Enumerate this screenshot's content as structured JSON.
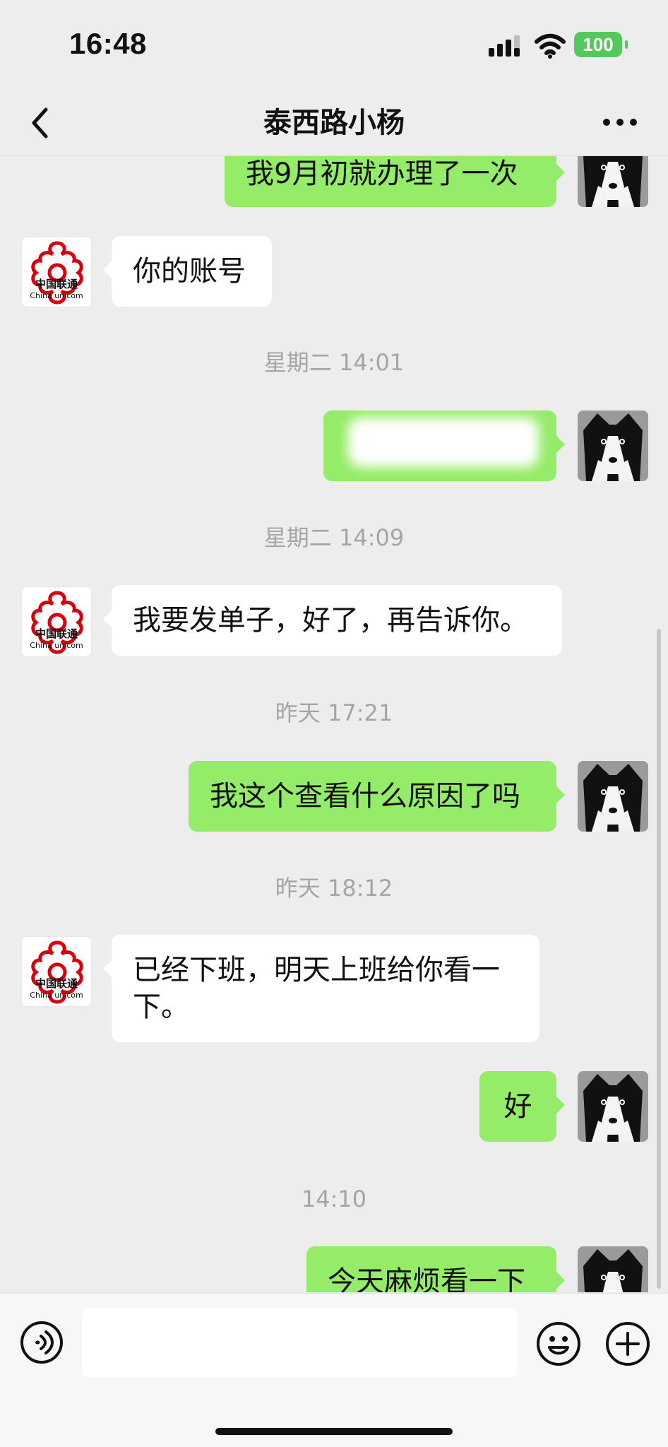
{
  "status_bar": {
    "time": "16:48",
    "battery": "100"
  },
  "header": {
    "title": "泰西路小杨"
  },
  "messages": [
    {
      "side": "outgoing",
      "text": "我9月初就办理了一次"
    },
    {
      "side": "incoming",
      "text": "你的账号"
    },
    {
      "side": "timestamp",
      "text": "星期二 14:01"
    },
    {
      "side": "outgoing",
      "text": ""
    },
    {
      "side": "timestamp",
      "text": "星期二 14:09"
    },
    {
      "side": "incoming",
      "text": "我要发单子，好了，再告诉你。"
    },
    {
      "side": "timestamp",
      "text": "昨天 17:21"
    },
    {
      "side": "outgoing",
      "text": "我这个查看什么原因了吗"
    },
    {
      "side": "timestamp",
      "text": "昨天 18:12"
    },
    {
      "side": "incoming",
      "text": "已经下班，明天上班给你看一下。"
    },
    {
      "side": "outgoing",
      "text": "好"
    },
    {
      "side": "timestamp",
      "text": "14:10"
    },
    {
      "side": "outgoing",
      "text": "今天麻烦看一下"
    }
  ],
  "contact_avatar": {
    "label": "中国联通",
    "sublabel": "China unicom",
    "accent": "#d7000f"
  },
  "colors": {
    "background": "#ededed",
    "outgoing_bubble": "#95ec69",
    "incoming_bubble": "#ffffff",
    "battery": "#55c85b"
  },
  "input": {
    "value": "",
    "placeholder": ""
  },
  "icons": {
    "back": "chevron-left-icon",
    "more": "more-dots-icon",
    "voice": "voice-icon",
    "emoji": "emoji-icon",
    "plus": "plus-icon"
  }
}
